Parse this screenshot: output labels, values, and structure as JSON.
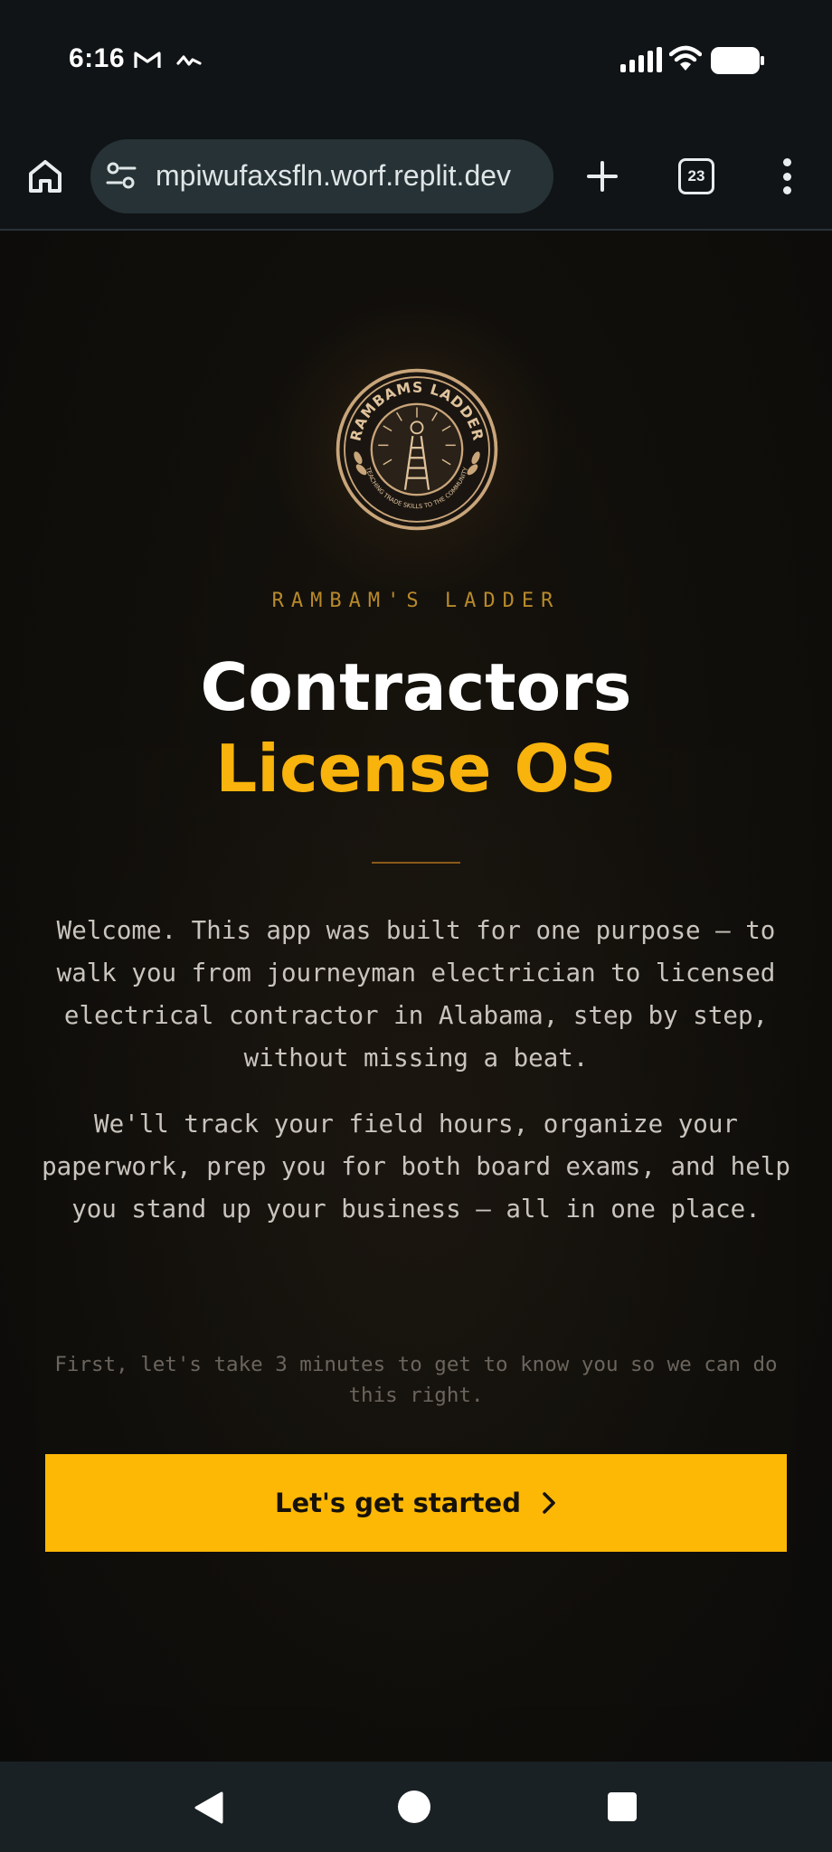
{
  "status_bar": {
    "time": "6:16",
    "icons": [
      "gmail-icon",
      "activity-icon",
      "signal-icon",
      "wifi-icon",
      "battery-icon"
    ]
  },
  "browser": {
    "url": "mpiwufaxsfln.worf.replit.dev",
    "tab_count": "23",
    "icons": [
      "home-icon",
      "site-settings-icon",
      "plus-icon",
      "tabs-icon",
      "more-vertical-icon"
    ]
  },
  "page": {
    "brand_overline": "RAMBAM'S LADDER",
    "title_line1": "Contractors",
    "title_line2": "License OS",
    "intro_paragraph_1": "Welcome. This app was built for one purpose — to walk you from journeyman electrician to licensed electrical contractor in Alabama, step by step, without missing a beat.",
    "intro_paragraph_2": "We'll track your field hours, organize your paperwork, prep you for both board exams, and help you stand up your business — all in one place.",
    "prompt": "First, let's take 3 minutes to get to know you so we can do this right.",
    "cta_label": "Let's get started",
    "logo": {
      "top_text": "RAMBAMS LADDER",
      "bottom_text": "TEACHING TRADE SKILLS TO THE COMMUNITY"
    }
  },
  "colors": {
    "accent": "#fdb805",
    "title_accent": "#f8b30c",
    "overline": "#b88a2a",
    "background": "#0c0e0f"
  }
}
